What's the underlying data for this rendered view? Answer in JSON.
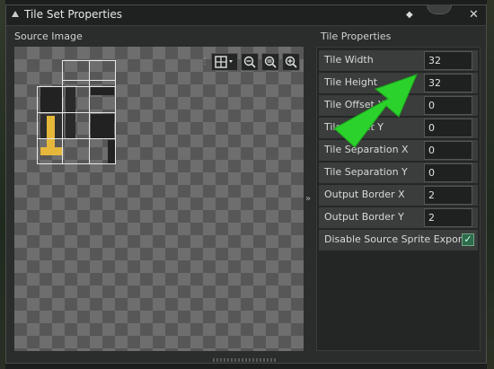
{
  "window": {
    "title": "Tile Set Properties"
  },
  "source": {
    "label": "Source Image",
    "zoom_tools": [
      "grid-toggle",
      "zoom-out",
      "zoom-reset",
      "zoom-in"
    ]
  },
  "splitter": {
    "glyph": "»"
  },
  "properties": {
    "label": "Tile Properties",
    "rows": [
      {
        "label": "Tile Width",
        "value": "32"
      },
      {
        "label": "Tile Height",
        "value": "32"
      },
      {
        "label": "Tile Offset X",
        "value": "0"
      },
      {
        "label": "Tile Offset Y",
        "value": "0"
      },
      {
        "label": "Tile Separation X",
        "value": "0"
      },
      {
        "label": "Tile Separation Y",
        "value": "0"
      },
      {
        "label": "Output Border X",
        "value": "2"
      },
      {
        "label": "Output Border Y",
        "value": "2"
      }
    ],
    "checkbox": {
      "label": "Disable Source Sprite Export",
      "checked": true
    }
  },
  "annotation": {
    "arrow_color": "#2bd22b"
  },
  "colors": {
    "accent_yellow": "#e5b73b",
    "check_green": "#2e6b4a"
  }
}
